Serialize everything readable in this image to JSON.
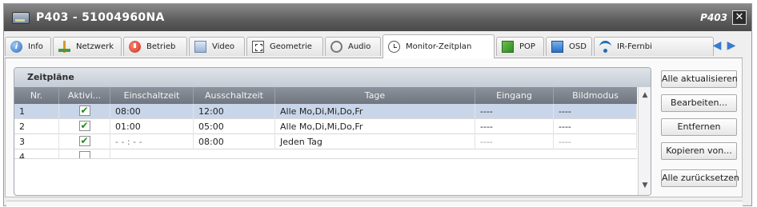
{
  "window": {
    "title": "P403 - 51004960NA",
    "title_right": "P403",
    "close_glyph": "✕"
  },
  "tabs": [
    {
      "label": "Info",
      "icon": "info-icon"
    },
    {
      "label": "Netzwerk",
      "icon": "network-icon"
    },
    {
      "label": "Betrieb",
      "icon": "power-icon"
    },
    {
      "label": "Video",
      "icon": "video-icon"
    },
    {
      "label": "Geometrie",
      "icon": "geometry-icon"
    },
    {
      "label": "Audio",
      "icon": "audio-icon"
    },
    {
      "label": "Monitor-Zeitplan",
      "icon": "clock-icon",
      "active": true
    },
    {
      "label": "POP",
      "icon": "pop-icon"
    },
    {
      "label": "OSD",
      "icon": "osd-icon"
    },
    {
      "label": "IR-Fernbi",
      "icon": "ir-remote-icon"
    }
  ],
  "tab_nav": {
    "prev": "◀",
    "next": "▶"
  },
  "schedule": {
    "group_title": "Zeitpläne",
    "columns": [
      "Nr.",
      "Aktivi...",
      "Einschaltzeit",
      "Ausschaltzeit",
      "Tage",
      "Eingang",
      "Bildmodus"
    ],
    "rows": [
      {
        "nr": "1",
        "active": true,
        "on": "08:00",
        "off": "12:00",
        "days": "Alle Mo,Di,Mi,Do,Fr",
        "input": "----",
        "mode": "----",
        "selected": true
      },
      {
        "nr": "2",
        "active": true,
        "on": "01:00",
        "off": "05:00",
        "days": "Alle Mo,Di,Mi,Do,Fr",
        "input": "----",
        "mode": "----",
        "selected": false
      },
      {
        "nr": "3",
        "active": true,
        "on": "- - : - -",
        "off": "08:00",
        "days": "Jeden Tag",
        "input": "----",
        "mode": "----",
        "selected": false
      },
      {
        "nr": "4",
        "active": false,
        "on": "",
        "off": "",
        "days": "",
        "input": "",
        "mode": "",
        "selected": false
      }
    ],
    "scroll_up": "▲",
    "scroll_down": "▼"
  },
  "buttons": {
    "refresh_all": "Alle aktualisieren",
    "edit": "Bearbeiten...",
    "remove": "Entfernen",
    "copy_from": "Kopieren von...",
    "reset_all": "Alle zurücksetzen"
  }
}
